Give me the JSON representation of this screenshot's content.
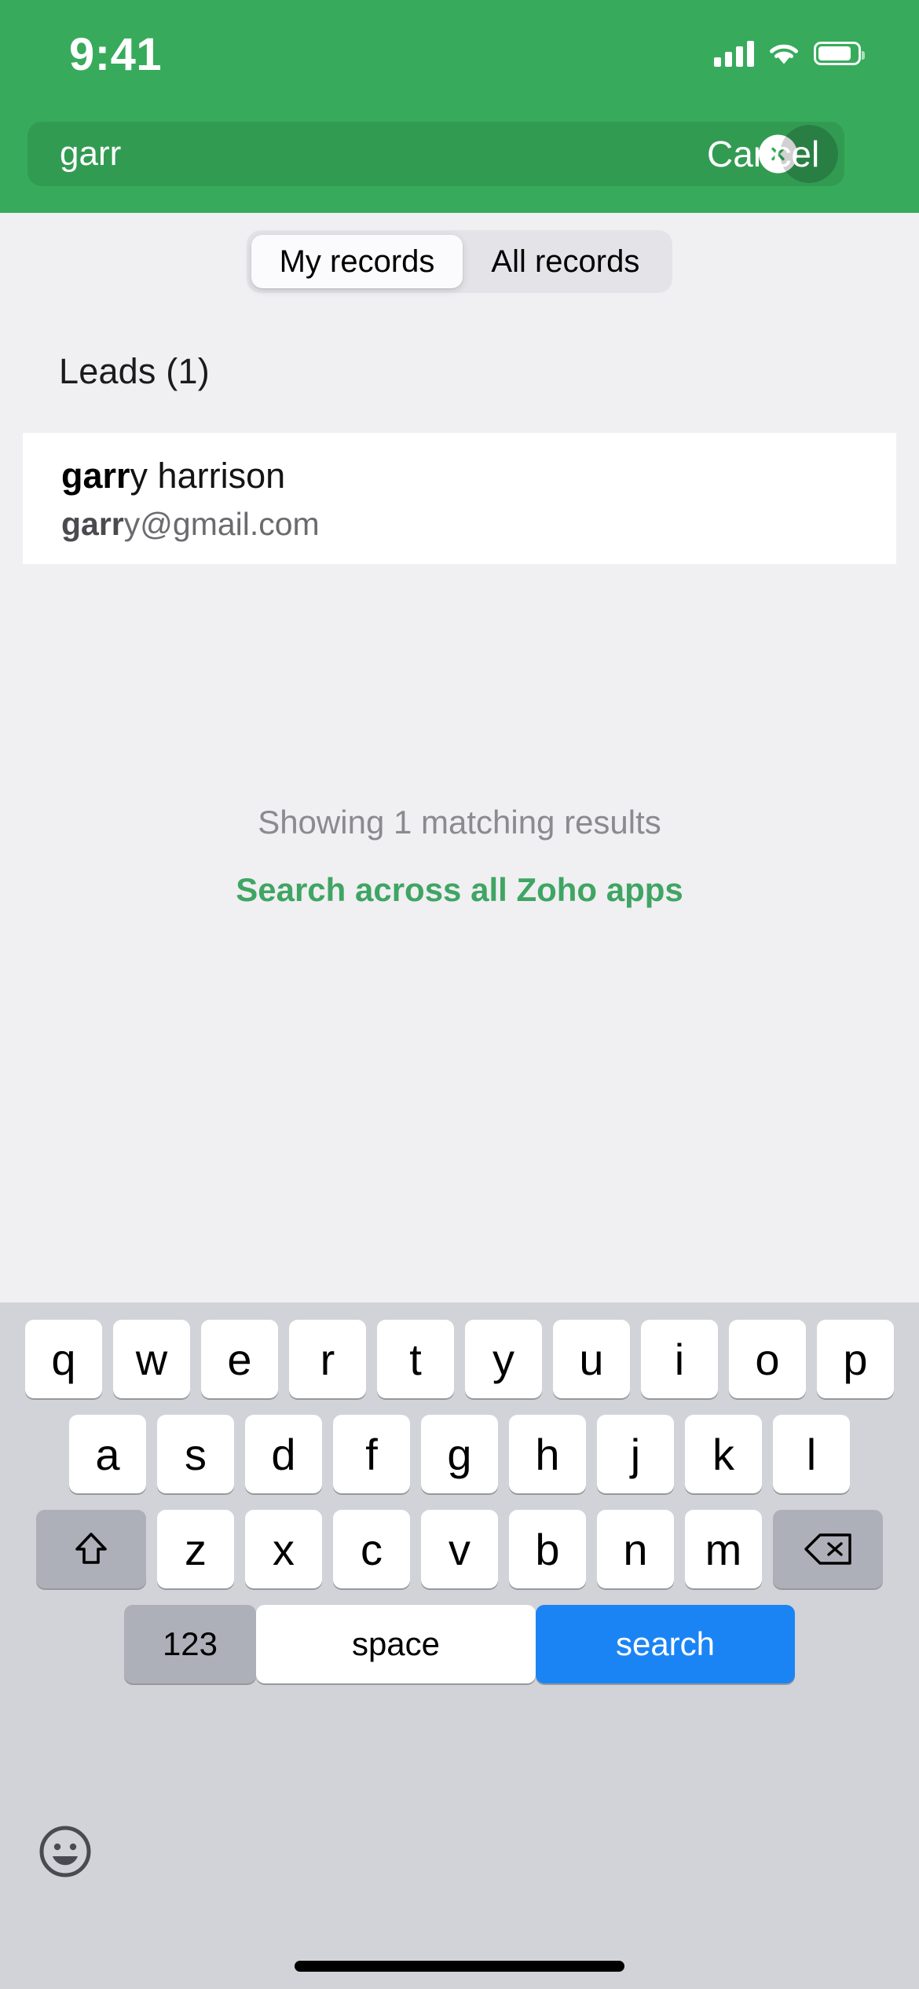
{
  "status_bar": {
    "time": "9:41",
    "cellular_icon": "signal-bars-icon",
    "wifi_icon": "wifi-icon",
    "battery_icon": "battery-icon"
  },
  "search": {
    "value": "garr",
    "placeholder": "Search",
    "clear_icon": "clear-circle-icon",
    "cancel_label": "Cancel"
  },
  "segmented_control": {
    "options": [
      {
        "label": "My records",
        "selected": true
      },
      {
        "label": "All records",
        "selected": false
      }
    ]
  },
  "results": {
    "section_title": "Leads (1)",
    "items": [
      {
        "name_match": "garr",
        "name_rest": "y harrison",
        "email_match": "garr",
        "email_rest": "y@gmail.com"
      }
    ],
    "showing_text": "Showing 1 matching results",
    "all_apps_link": "Search across all Zoho apps"
  },
  "keyboard": {
    "row1": [
      "q",
      "w",
      "e",
      "r",
      "t",
      "y",
      "u",
      "i",
      "o",
      "p"
    ],
    "row2": [
      "a",
      "s",
      "d",
      "f",
      "g",
      "h",
      "j",
      "k",
      "l"
    ],
    "row3": [
      "z",
      "x",
      "c",
      "v",
      "b",
      "n",
      "m"
    ],
    "shift_icon": "shift-arrow-icon",
    "delete_icon": "backspace-icon",
    "numbers_label": "123",
    "space_label": "space",
    "search_label": "search",
    "emoji_icon": "emoji-smiley-icon"
  },
  "colors": {
    "header_green": "#37ab5b",
    "link_green": "#3fa563",
    "search_key_blue": "#1b84f5",
    "page_background": "#f0eff2",
    "keyboard_background": "#d1d3d9"
  }
}
